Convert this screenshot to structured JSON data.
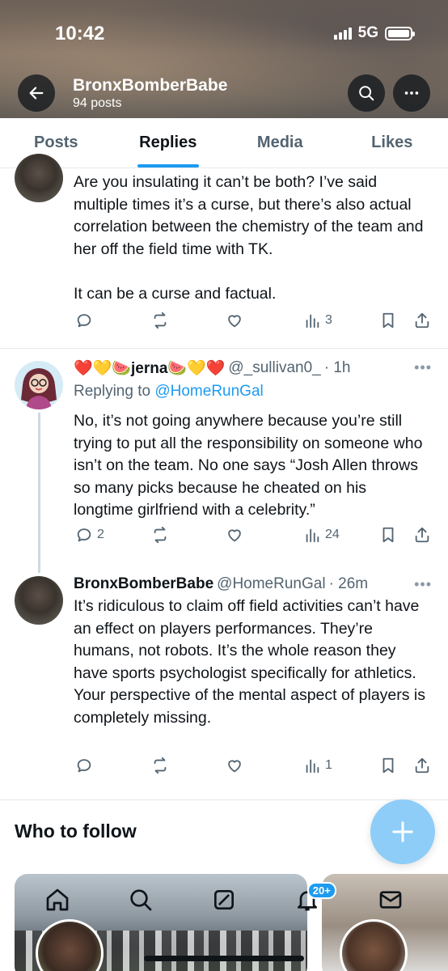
{
  "status_bar": {
    "time": "10:42",
    "network": "5G"
  },
  "header": {
    "name": "BronxBomberBabe",
    "posts": "94 posts"
  },
  "tabs": [
    {
      "label": "Posts",
      "active": false
    },
    {
      "label": "Replies",
      "active": true
    },
    {
      "label": "Media",
      "active": false
    },
    {
      "label": "Likes",
      "active": false
    }
  ],
  "tweets": [
    {
      "text": "Are you insulating it can’t be both? I’ve said multiple times it’s a curse, but there’s also actual correlation between the chemistry of the team and her off the field time with TK.\n\nIt can be a curse and factual.",
      "replies": "",
      "reposts": "",
      "likes": "",
      "views": "3"
    },
    {
      "name": "❤️💛🍉jerna🍉💛❤️",
      "handle": "@_sullivan0_",
      "time": "· 1h",
      "replying_prefix": "Replying to ",
      "replying_to": "@HomeRunGal",
      "text": "No, it’s not going anywhere because you’re still trying to put all the responsibility on someone who isn’t on the team. No one says “Josh Allen throws so many picks because he cheated on his longtime girlfriend with a celebrity.”",
      "replies": "2",
      "reposts": "",
      "likes": "",
      "views": "24"
    },
    {
      "name": "BronxBomberBabe",
      "handle": "@HomeRunGal",
      "time": "· 26m",
      "text": "It’s ridiculous to claim off field activities can’t have an effect on players performances. They’re humans, not robots. It’s the whole reason they have sports psychologist specifically for athletics. Your perspective of the mental aspect of players is completely missing.",
      "replies": "",
      "reposts": "",
      "likes": "",
      "views": "1"
    }
  ],
  "who_to_follow": {
    "title": "Who to follow"
  },
  "fab": {
    "icon": "plus-icon"
  },
  "bottom_nav": {
    "items": [
      "home-icon",
      "search-icon",
      "grok-icon",
      "notifications-icon",
      "messages-icon"
    ],
    "notifications_badge": "20+"
  },
  "colors": {
    "accent": "#1d9bf0",
    "secondary_text": "#536471",
    "fab": "#8ecdf8"
  }
}
